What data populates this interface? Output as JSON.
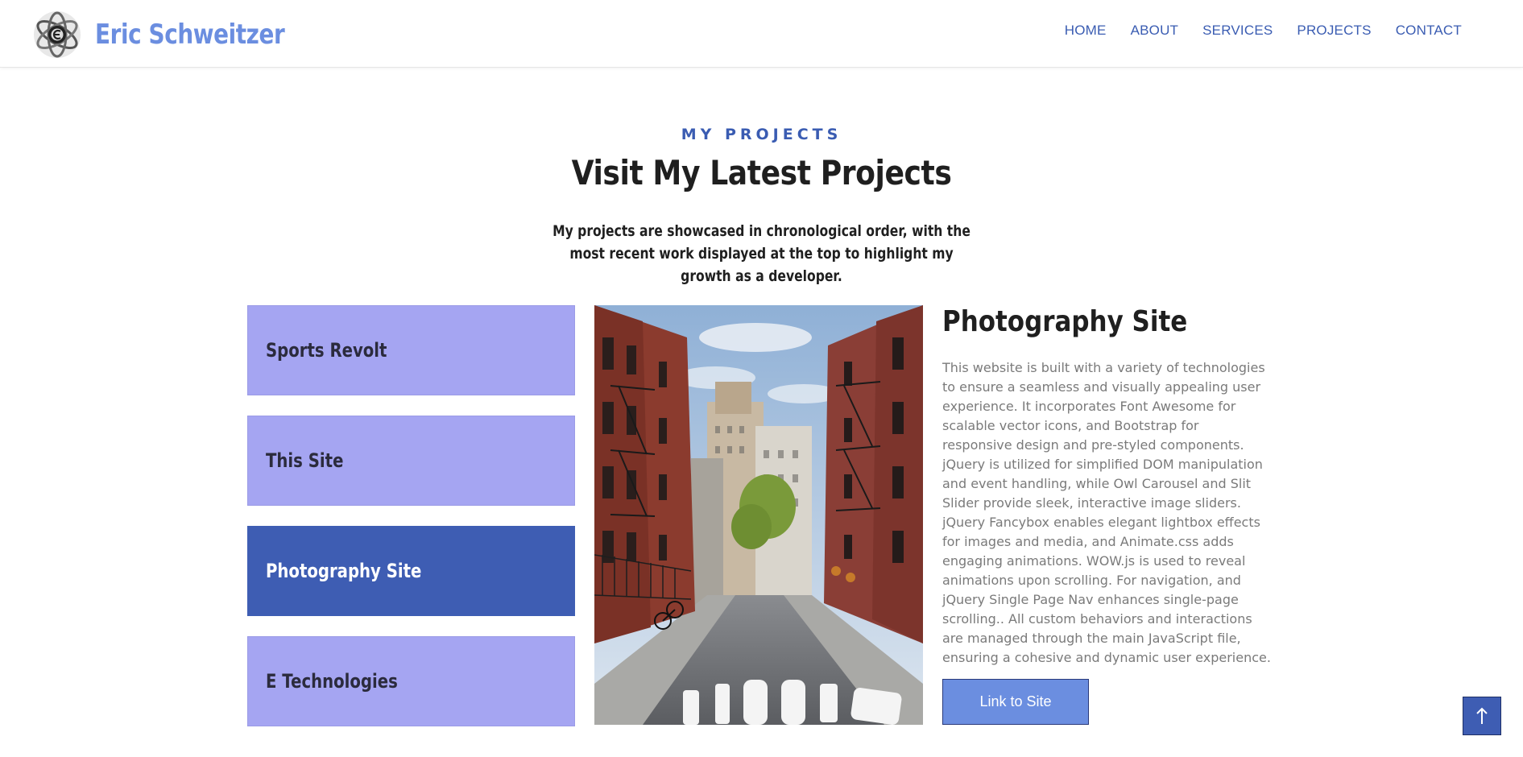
{
  "header": {
    "brand_name": "Eric Schweitzer",
    "logo_icon": "atom-e-logo-icon",
    "nav": [
      "HOME",
      "ABOUT",
      "SERVICES",
      "PROJECTS",
      "CONTACT"
    ]
  },
  "section": {
    "eyebrow": "MY PROJECTS",
    "title": "Visit My Latest Projects",
    "intro": "My projects are showcased in chronological order, with the most recent work displayed at the top to highlight my growth as a developer."
  },
  "projects": [
    {
      "label": "Sports Revolt",
      "active": false
    },
    {
      "label": "This Site",
      "active": false
    },
    {
      "label": "Photography Site",
      "active": true
    },
    {
      "label": "E Technologies",
      "active": false
    }
  ],
  "detail": {
    "title": "Photography Site",
    "description": "This website is built with a variety of technologies to ensure a seamless and visually appealing user experience. It incorporates Font Awesome for scalable vector icons, and Bootstrap for responsive design and pre-styled components. jQuery is utilized for simplified DOM manipulation and event handling, while Owl Carousel and Slit Slider provide sleek, interactive image sliders. jQuery Fancybox enables elegant lightbox effects for images and media, and Animate.css adds engaging animations. WOW.js is used to reveal animations upon scrolling. For navigation, and jQuery Single Page Nav enhances single-page scrolling.. All custom behaviors and interactions are managed through the main JavaScript file, ensuring a cohesive and dynamic user experience.",
    "link_label": "Link to Site",
    "image_icon": "city-street-photo"
  },
  "to_top_icon": "arrow-up-icon",
  "colors": {
    "accent": "#3e5db3",
    "brand": "#6b8ee0",
    "item_bg": "#a5a5f2",
    "text_dark": "#1f1f1f",
    "text_muted": "#7a7a7a"
  }
}
